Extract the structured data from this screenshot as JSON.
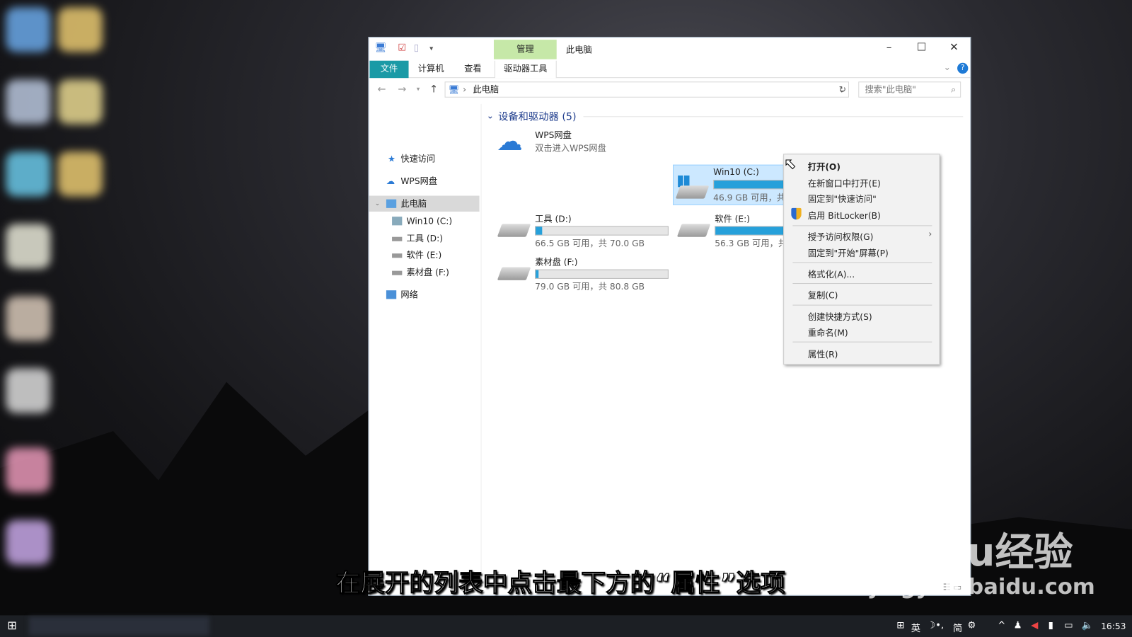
{
  "window": {
    "title": "此电脑",
    "context_tab": "管理",
    "controls": {
      "minimize": "–",
      "maximize": "☐",
      "close": "✕"
    }
  },
  "ribbon": {
    "tabs": [
      "文件",
      "计算机",
      "查看",
      "驱动器工具"
    ],
    "help": "?"
  },
  "address": {
    "path": "此电脑",
    "search_placeholder": "搜索\"此电脑\""
  },
  "tree": [
    {
      "label": "快速访问",
      "icon": "star-icon"
    },
    {
      "label": "WPS网盘",
      "icon": "cloud-icon"
    },
    {
      "label": "此电脑",
      "icon": "computer-icon",
      "selected": true
    },
    {
      "label": "Win10 (C:)",
      "icon": "drive-icon"
    },
    {
      "label": "工具 (D:)",
      "icon": "drive-icon"
    },
    {
      "label": "软件 (E:)",
      "icon": "drive-icon"
    },
    {
      "label": "素材盘 (F:)",
      "icon": "drive-icon"
    },
    {
      "label": "网络",
      "icon": "network-icon"
    }
  ],
  "group": {
    "title": "设备和驱动器 (5)"
  },
  "wps": {
    "name": "WPS网盘",
    "desc": "双击进入WPS网盘"
  },
  "drives": [
    {
      "name": "Win10 (C:)",
      "size": "46.9 GB 可用，共",
      "used_pct": 58,
      "selected": true
    },
    {
      "name": "工具 (D:)",
      "size": "66.5 GB 可用，共 70.0 GB",
      "used_pct": 5
    },
    {
      "name": "软件 (E:)",
      "size": "56.3 GB 可用，共",
      "used_pct": 55
    },
    {
      "name": "素材盘 (F:)",
      "size": "79.0 GB 可用，共 80.8 GB",
      "used_pct": 2
    }
  ],
  "context_menu": [
    "打开(O)",
    "在新窗口中打开(E)",
    "固定到\"快速访问\"",
    "启用 BitLocker(B)",
    "授予访问权限(G)",
    "固定到\"开始\"屏幕(P)",
    "格式化(A)...",
    "复制(C)",
    "创建快捷方式(S)",
    "重命名(M)",
    "属性(R)"
  ],
  "caption": "在展开的列表中点击最下方的“属性”选项",
  "watermark": {
    "brand": "Baidu经验",
    "url": "jingyan.baidu.com"
  },
  "taskbar": {
    "ime": "英",
    "ime2": "简",
    "clock": "16:53"
  },
  "colors": {
    "accent": "#1a9aa6",
    "manage_tab": "#c6e8a8",
    "selection": "#cce8ff",
    "bar": "#26a0da"
  }
}
